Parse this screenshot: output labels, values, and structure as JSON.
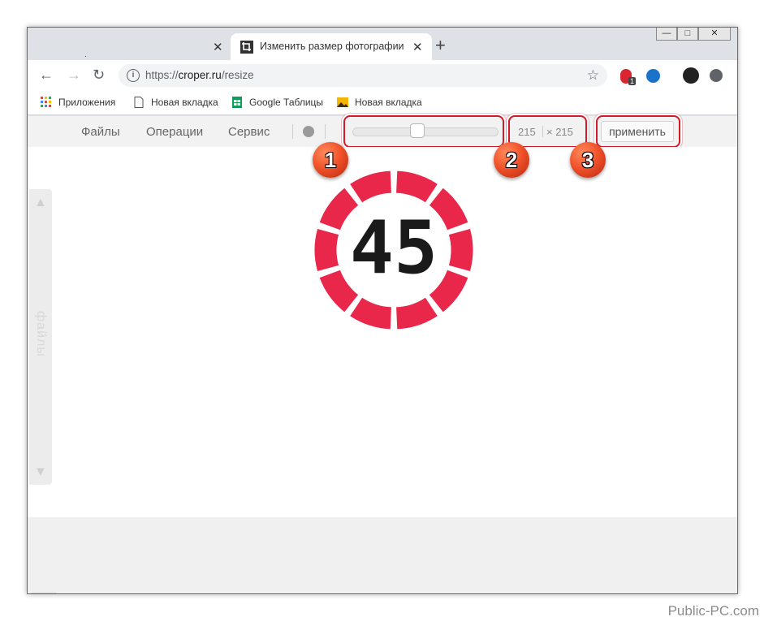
{
  "browser": {
    "tabs": [
      {
        "title": ".",
        "close": "✕"
      },
      {
        "title": "Изменить размер фотографии онлайн",
        "close": "✕"
      }
    ],
    "new_tab": "+",
    "window_controls": [
      "—",
      "□",
      "✕"
    ],
    "url": {
      "scheme": "https://",
      "host": "croper.ru",
      "path": "/resize"
    },
    "extension_badge": "1",
    "bookmarks": [
      {
        "label": "Приложения",
        "icon": "apps-grid-icon"
      },
      {
        "label": "Новая вкладка",
        "icon": "page-icon"
      },
      {
        "label": "Google Таблицы",
        "icon": "sheets-icon"
      },
      {
        "label": "Новая вкладка",
        "icon": "image-icon"
      }
    ]
  },
  "app": {
    "menu": [
      "Файлы",
      "Операции",
      "Сервис"
    ],
    "slider_value": 0.44,
    "width": "215",
    "height": "× 215",
    "apply_label": "применить",
    "side_label": "файлы",
    "image_text": "45"
  },
  "annotations": [
    "1",
    "2",
    "3"
  ],
  "colors": {
    "accent": "#e8274b",
    "highlight": "#d4192b"
  },
  "watermark": "Public-PC.com"
}
